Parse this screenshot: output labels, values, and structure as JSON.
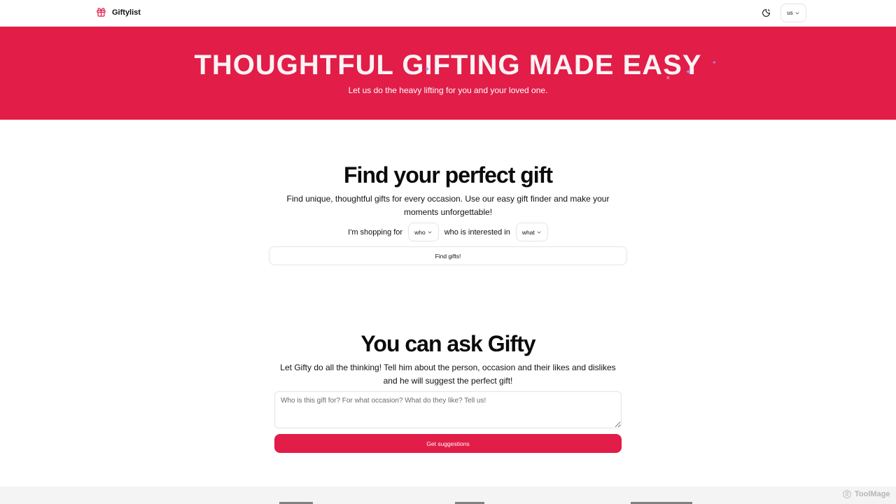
{
  "header": {
    "brand": "Giftylist",
    "language": "us"
  },
  "hero": {
    "title": "THOUGHTFUL GIFTING MADE EASY",
    "subtitle": "Let us do the heavy lifting for you and your loved one."
  },
  "finder": {
    "title": "Find your perfect gift",
    "description": "Find unique, thoughtful gifts for every occasion. Use our easy gift finder and make your moments unforgettable!",
    "shopping_for_label": "I'm shopping for",
    "who_value": "who",
    "interested_label": "who is interested in",
    "what_value": "what",
    "button_label": "Find gifts!"
  },
  "ask": {
    "title": "You can ask Gifty",
    "description": "Let Gifty do all the thinking! Tell him about the person, occasion and their likes and dislikes and he will suggest the perfect gift!",
    "placeholder": "Who is this gift for? For what occasion? What do they like? Tell us!",
    "button_label": "Get suggestions"
  },
  "watermark": "ToolMage",
  "colors": {
    "brand": "#e11d48",
    "hero_text": "#fdf2f4",
    "sparkle": "#a78bfa"
  },
  "icons": [
    "gift-icon",
    "theme-toggle-icon",
    "chevron-down-icon",
    "sparkle-icon",
    "toolmage-logo-icon"
  ]
}
